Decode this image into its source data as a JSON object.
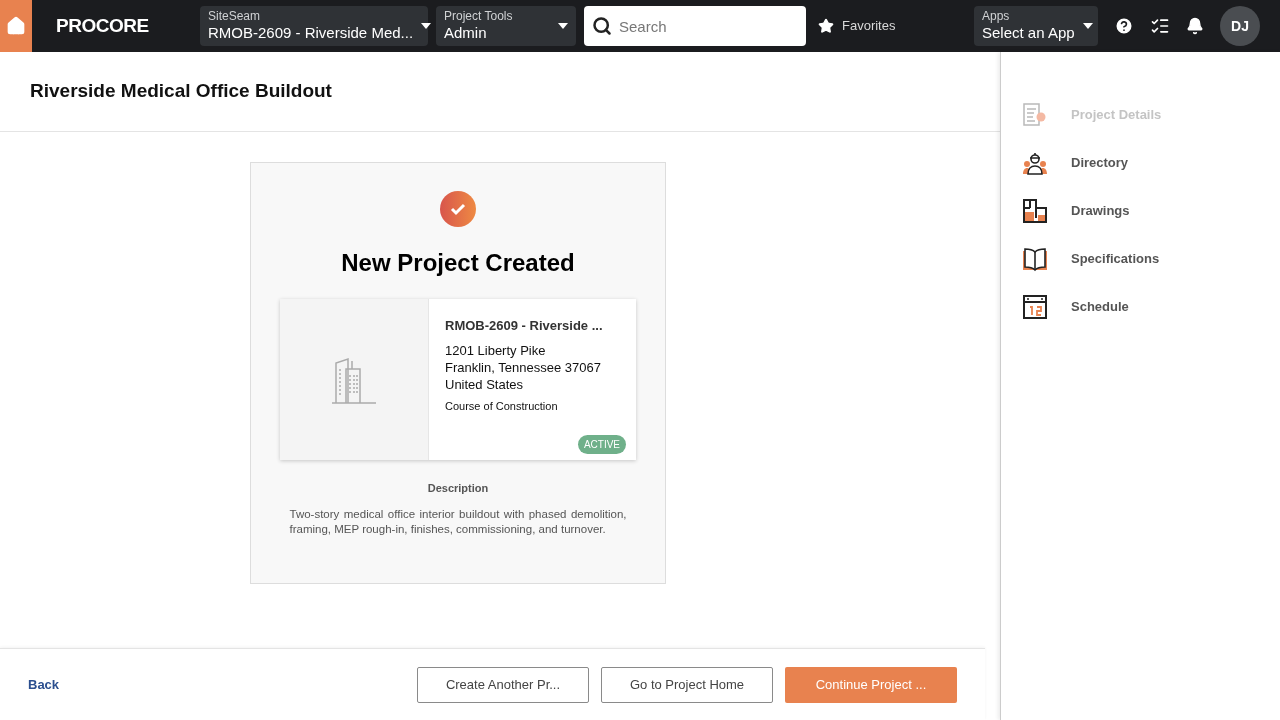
{
  "header": {
    "logo": "PROCORE",
    "project_picker": {
      "label": "SiteSeam",
      "value": "RMOB-2609 - Riverside Med..."
    },
    "tools_picker": {
      "label": "Project Tools",
      "value": "Admin"
    },
    "search": {
      "placeholder": "Search"
    },
    "favorites": "Favorites",
    "apps_picker": {
      "label": "Apps",
      "value": "Select an App"
    },
    "avatar": "DJ"
  },
  "page": {
    "title": "Riverside Medical Office Buildout"
  },
  "card": {
    "heading": "New Project Created",
    "project": {
      "name": "RMOB-2609 - Riverside ...",
      "address_lines": [
        "1201 Liberty Pike",
        "Franklin, Tennessee 37067",
        "United States"
      ],
      "stage": "Course of Construction",
      "status": "ACTIVE"
    },
    "description_label": "Description",
    "description": "Two-story medical office interior buildout with phased demolition, framing, MEP rough-in, finishes, commissioning, and turnover."
  },
  "footer": {
    "back": "Back",
    "buttons": [
      {
        "label": "Create Another Pr...",
        "kind": "outline"
      },
      {
        "label": "Go to Project Home",
        "kind": "outline"
      },
      {
        "label": "Continue Project ...",
        "kind": "primary"
      }
    ]
  },
  "sidebar": {
    "items": [
      {
        "label": "Project Details",
        "kind": "details",
        "disabled": true
      },
      {
        "label": "Directory",
        "kind": "directory",
        "disabled": false
      },
      {
        "label": "Drawings",
        "kind": "drawings",
        "disabled": false
      },
      {
        "label": "Specifications",
        "kind": "specs",
        "disabled": false
      },
      {
        "label": "Schedule",
        "kind": "schedule",
        "disabled": false
      }
    ]
  }
}
